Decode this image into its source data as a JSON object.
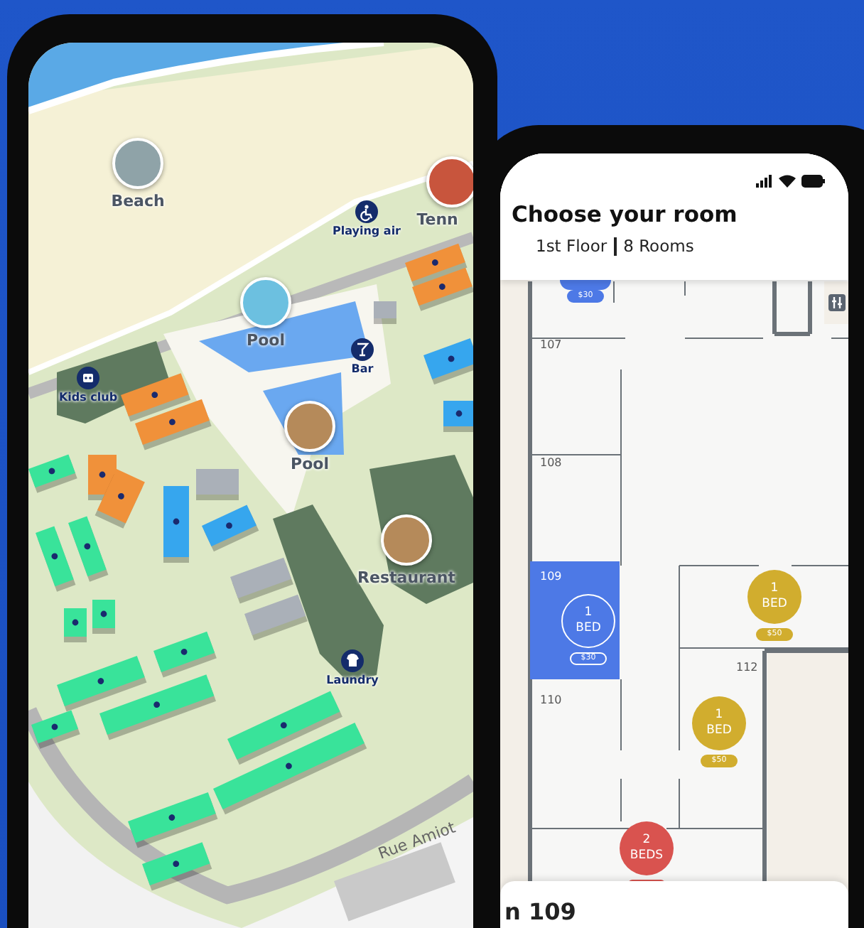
{
  "map_phone": {
    "pois": [
      {
        "label": "Beach",
        "kind": "photo"
      },
      {
        "label": "Tenn",
        "kind": "photo"
      },
      {
        "label": "Playing air",
        "kind": "icon"
      },
      {
        "label": "Pool",
        "kind": "photo"
      },
      {
        "label": "Bar",
        "kind": "icon"
      },
      {
        "label": "Kids club",
        "kind": "icon"
      },
      {
        "label": "Pool",
        "kind": "photo"
      },
      {
        "label": "Restaurant",
        "kind": "photo"
      },
      {
        "label": "Laundry",
        "kind": "icon"
      }
    ],
    "street_label": "Rue Amiot"
  },
  "rooms_phone": {
    "title": "Choose your room",
    "floor": "1st Floor",
    "room_count": "8 Rooms",
    "room_numbers": [
      "107",
      "108",
      "109",
      "110",
      "112"
    ],
    "markers": [
      {
        "kind": "cut",
        "price": "$30",
        "color": "#4d79e6",
        "selected": false
      },
      {
        "kind": "full",
        "beds": "1",
        "unit": "BED",
        "price": "$30",
        "color": "#4d79e6",
        "selected": true
      },
      {
        "kind": "full",
        "beds": "1",
        "unit": "BED",
        "price": "$50",
        "color": "#d1ad2e",
        "selected": false
      },
      {
        "kind": "full",
        "beds": "1",
        "unit": "BED",
        "price": "$50",
        "color": "#d1ad2e",
        "selected": false
      },
      {
        "kind": "full",
        "beds": "2",
        "unit": "BEDS",
        "color": "#d9534f",
        "selected": false
      }
    ],
    "sheet_title": "n 109"
  }
}
